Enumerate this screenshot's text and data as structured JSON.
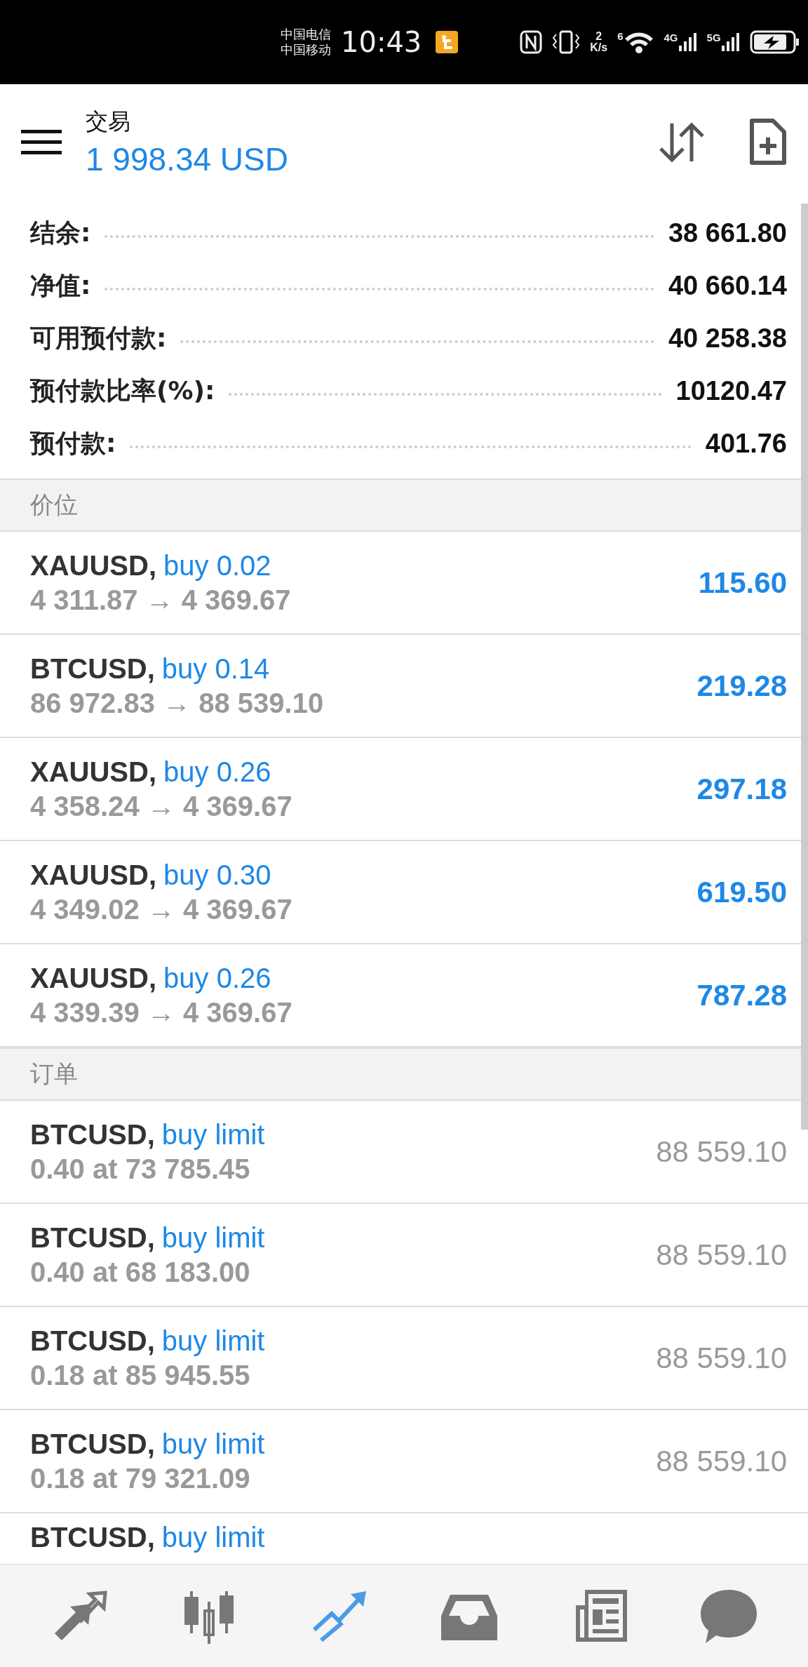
{
  "status_bar": {
    "carriers": [
      "中国电信",
      "中国移动"
    ],
    "time": "10:43",
    "speed_value": "2",
    "speed_unit": "K/s",
    "wifi_label": "6",
    "signals": [
      "4G",
      "5G"
    ]
  },
  "header": {
    "title": "交易",
    "balance": "1 998.34 USD"
  },
  "summary": [
    {
      "label": "结余:",
      "value": "38 661.80"
    },
    {
      "label": "净值:",
      "value": "40 660.14"
    },
    {
      "label": "可用预付款:",
      "value": "40 258.38"
    },
    {
      "label": "预付款比率(%):",
      "value": "10120.47"
    },
    {
      "label": "预付款:",
      "value": "401.76"
    }
  ],
  "positions": {
    "heading": "价位",
    "rows": [
      {
        "symbol": "XAUUSD,",
        "side": "buy 0.02",
        "prices": "4 311.87 → 4 369.67",
        "profit": "115.60"
      },
      {
        "symbol": "BTCUSD,",
        "side": "buy 0.14",
        "prices": "86 972.83 → 88 539.10",
        "profit": "219.28"
      },
      {
        "symbol": "XAUUSD,",
        "side": "buy 0.26",
        "prices": "4 358.24 → 4 369.67",
        "profit": "297.18"
      },
      {
        "symbol": "XAUUSD,",
        "side": "buy 0.30",
        "prices": "4 349.02 → 4 369.67",
        "profit": "619.50"
      },
      {
        "symbol": "XAUUSD,",
        "side": "buy 0.26",
        "prices": "4 339.39 → 4 369.67",
        "profit": "787.28"
      }
    ]
  },
  "orders": {
    "heading": "订单",
    "rows": [
      {
        "symbol": "BTCUSD,",
        "type": "buy limit",
        "detail": "0.40 at 73 785.45",
        "price": "88 559.10"
      },
      {
        "symbol": "BTCUSD,",
        "type": "buy limit",
        "detail": "0.40 at 68 183.00",
        "price": "88 559.10"
      },
      {
        "symbol": "BTCUSD,",
        "type": "buy limit",
        "detail": "0.18 at 85 945.55",
        "price": "88 559.10"
      },
      {
        "symbol": "BTCUSD,",
        "type": "buy limit",
        "detail": "0.18 at 79 321.09",
        "price": "88 559.10"
      },
      {
        "symbol": "BTCUSD,",
        "type": "buy limit"
      }
    ]
  },
  "nav": [
    {
      "kind": "trade",
      "selected": false
    },
    {
      "kind": "chart",
      "selected": false
    },
    {
      "kind": "trading",
      "selected": true
    },
    {
      "kind": "history",
      "selected": false
    },
    {
      "kind": "news",
      "selected": false
    },
    {
      "kind": "chat",
      "selected": false
    }
  ]
}
